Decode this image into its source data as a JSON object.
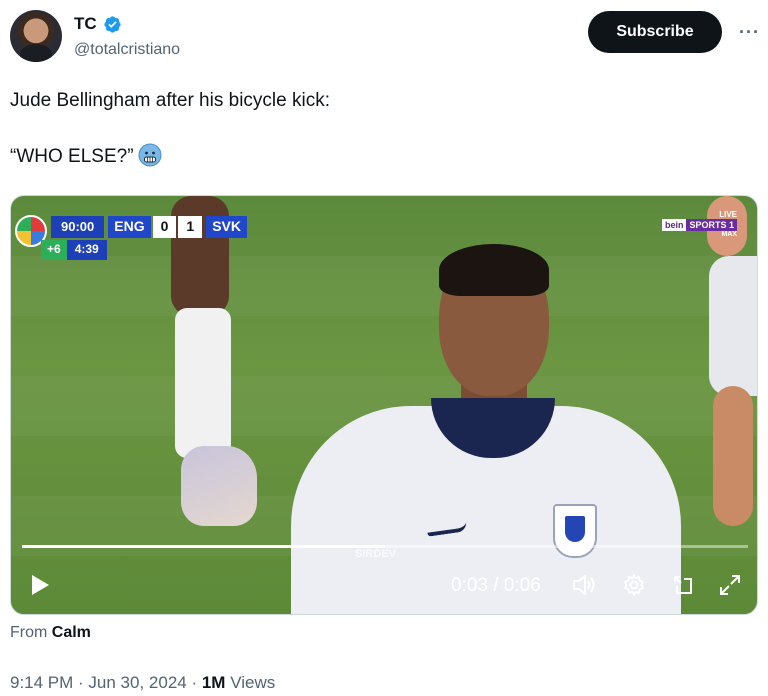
{
  "author": {
    "name": "TC",
    "handle": "@totalcristiano",
    "verified": true
  },
  "actions": {
    "subscribe_label": "Subscribe",
    "more_label": "···"
  },
  "tweet": {
    "line1": "Jude Bellingham after his bicycle kick:",
    "line2": "“WHO ELSE?”",
    "emoji": "cold-face-emoji"
  },
  "video": {
    "scoreboard": {
      "clock": "90:00",
      "home_team": "ENG",
      "home_score": "0",
      "away_score": "1",
      "away_team": "SVK",
      "added_label": "+6",
      "added_time": "4:39"
    },
    "broadcaster": {
      "live": "LIVE",
      "name_part1": "bein",
      "name_part2": "SPORTS 1",
      "tier": "MAX"
    },
    "watermark": "SIRDEV",
    "progress": 0.5,
    "time_display": "0:03 / 0:06"
  },
  "source": {
    "prefix": "From",
    "name": "Calm"
  },
  "meta": {
    "timestamp": "9:14 PM · Jun 30, 2024 · ",
    "views_count": "1M",
    "views_label": " Views"
  }
}
